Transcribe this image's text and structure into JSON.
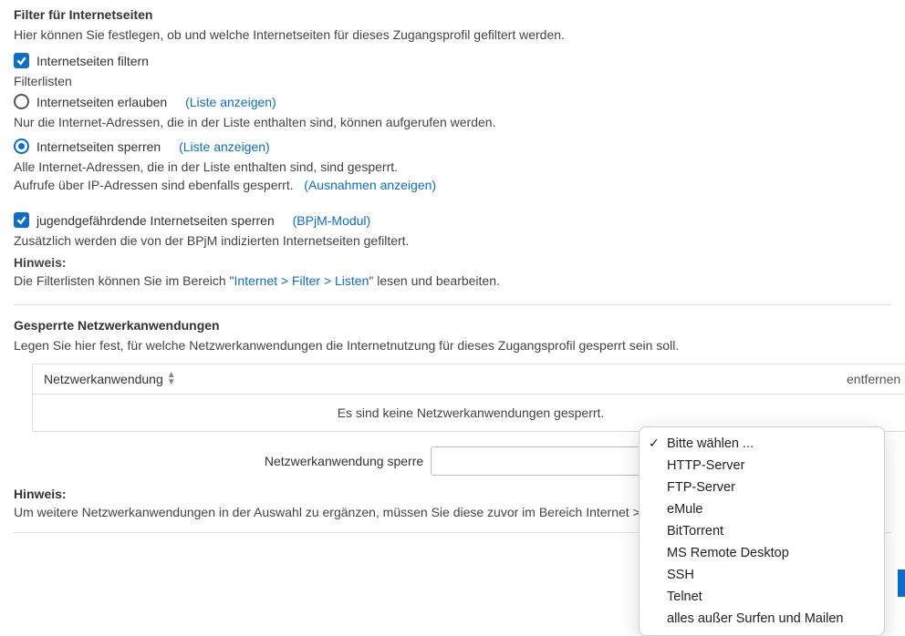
{
  "filter": {
    "heading": "Filter für Internetseiten",
    "desc": "Hier können Sie festlegen, ob und welche Internetseiten für dieses Zugangsprofil gefiltert werden.",
    "enable_label": "Internetseiten filtern",
    "listen_heading": "Filterlisten",
    "allow": {
      "label": "Internetseiten erlauben",
      "show": "(Liste anzeigen)",
      "desc": "Nur die Internet-Adressen, die in der Liste enthalten sind, können aufgerufen werden."
    },
    "block": {
      "label": "Internetseiten sperren",
      "show": "(Liste anzeigen)",
      "desc1": "Alle Internet-Adressen, die in der Liste enthalten sind, sind gesperrt.",
      "desc2a": "Aufrufe über IP-Adressen sind ebenfalls gesperrt.",
      "desc2b": "(Ausnahmen anzeigen)"
    },
    "bpjm": {
      "label": "jugendgefährdende Internetseiten sperren",
      "tag": "(BPjM-Modul)",
      "desc": "Zusätzlich werden die von der BPjM indizierten Internetseiten gefiltert."
    },
    "hint_label": "Hinweis:",
    "hint_a": "Die Filterlisten können Sie im Bereich \"",
    "hint_link": "Internet > Filter > Listen",
    "hint_b": "\" lesen und bearbeiten."
  },
  "netapps": {
    "heading": "Gesperrte Netzwerkanwendungen",
    "desc": "Legen Sie hier fest, für welche Netzwerkanwendungen die Internetnutzung für dieses Zugangsprofil gesperrt sein soll.",
    "col_app": "Netzwerkanwendung",
    "col_remove": "entfernen",
    "empty": "Es sind keine Netzwerkanwendungen gesperrt.",
    "block_label": "Netzwerkanwendung sperre",
    "select_placeholder": "Bitte wählen ...",
    "options": [
      "Bitte wählen ...",
      "HTTP-Server",
      "FTP-Server",
      "eMule",
      "BitTorrent",
      "MS Remote Desktop",
      "SSH",
      "Telnet",
      "alles außer Surfen und Mailen"
    ],
    "hint_label": "Hinweis:",
    "hint_text": "Um weitere Netzwerkanwendungen in der Auswahl zu ergänzen, müssen Sie diese zuvor im Bereich Internet > Filter"
  }
}
